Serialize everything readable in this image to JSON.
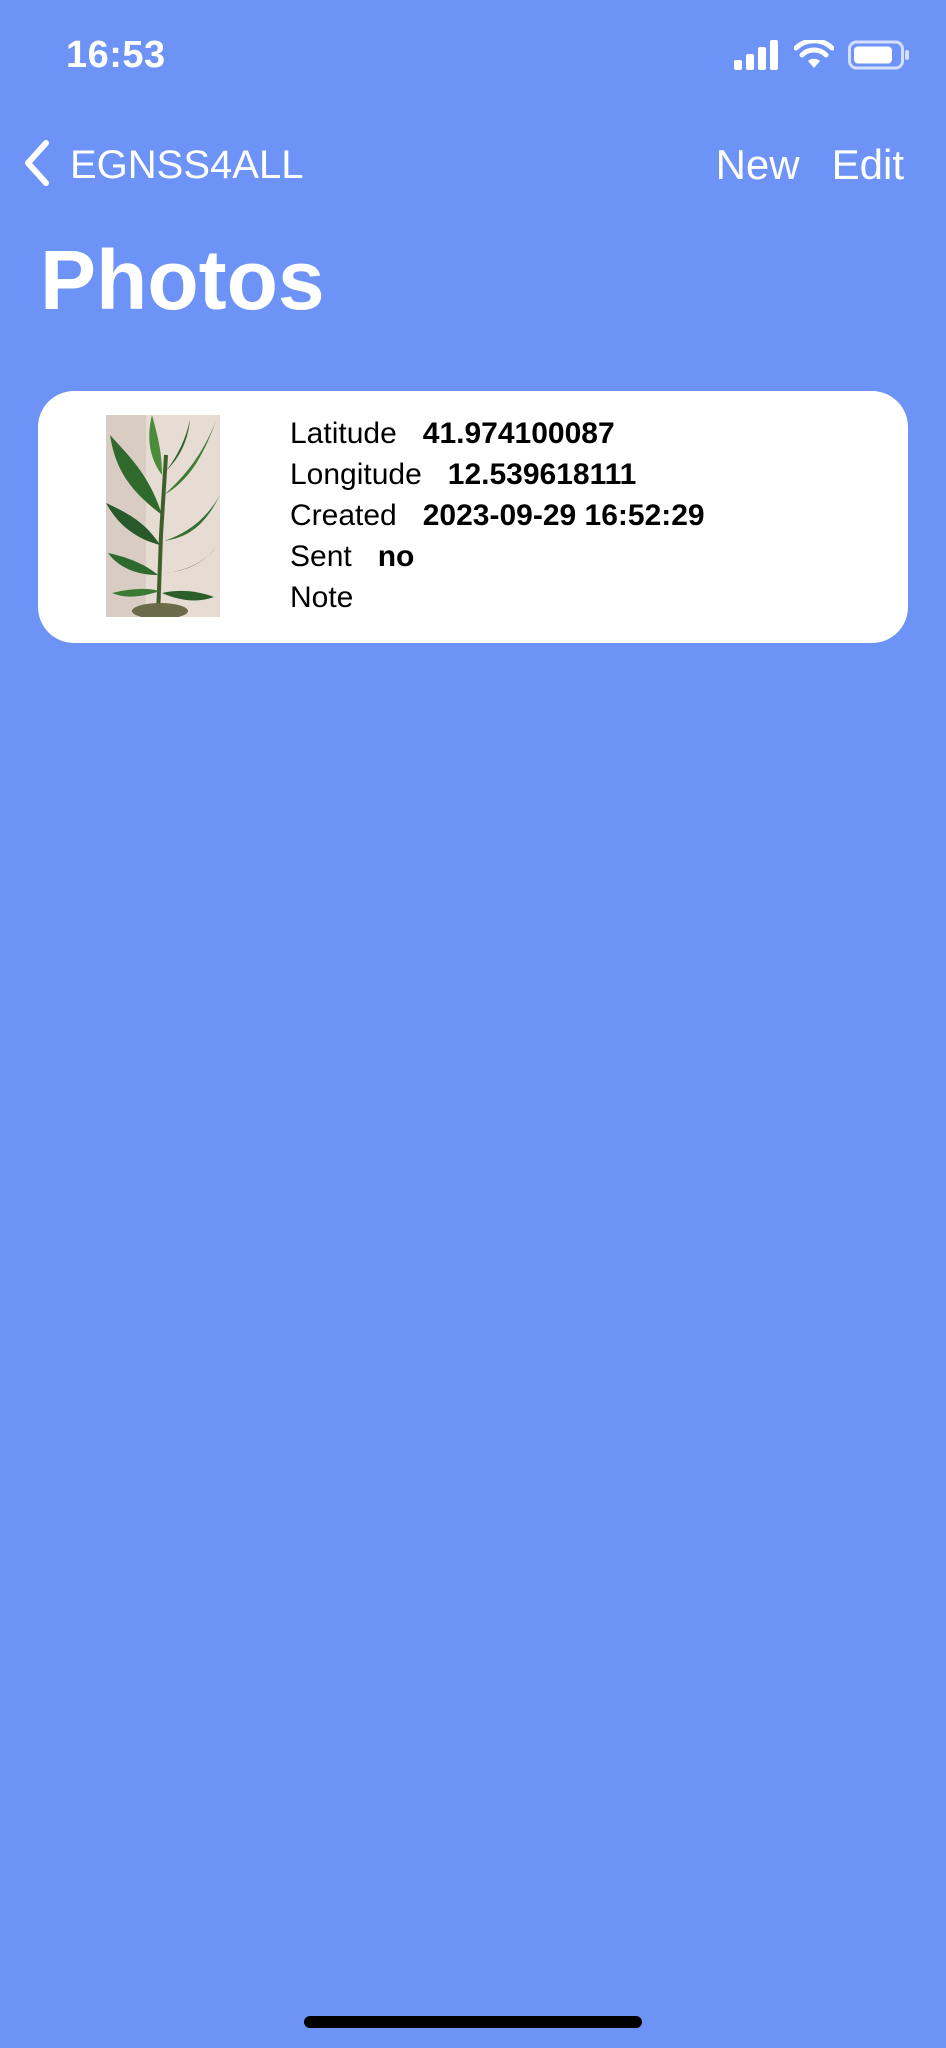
{
  "status_bar": {
    "time": "16:53",
    "icons": [
      "signal-icon",
      "wifi-icon",
      "battery-icon"
    ]
  },
  "nav": {
    "back_label": "EGNSS4ALL",
    "new_label": "New",
    "edit_label": "Edit"
  },
  "page": {
    "title": "Photos"
  },
  "photos": [
    {
      "latitude_label": "Latitude",
      "latitude_value": "41.974100087",
      "longitude_label": "Longitude",
      "longitude_value": "12.539618111",
      "created_label": "Created",
      "created_value": "2023-09-29 16:52:29",
      "sent_label": "Sent",
      "sent_value": "no",
      "note_label": "Note",
      "note_value": ""
    }
  ],
  "colors": {
    "background": "#6d93f7",
    "card": "#ffffff",
    "text_light": "#ffffff",
    "text_dark": "#000000"
  }
}
